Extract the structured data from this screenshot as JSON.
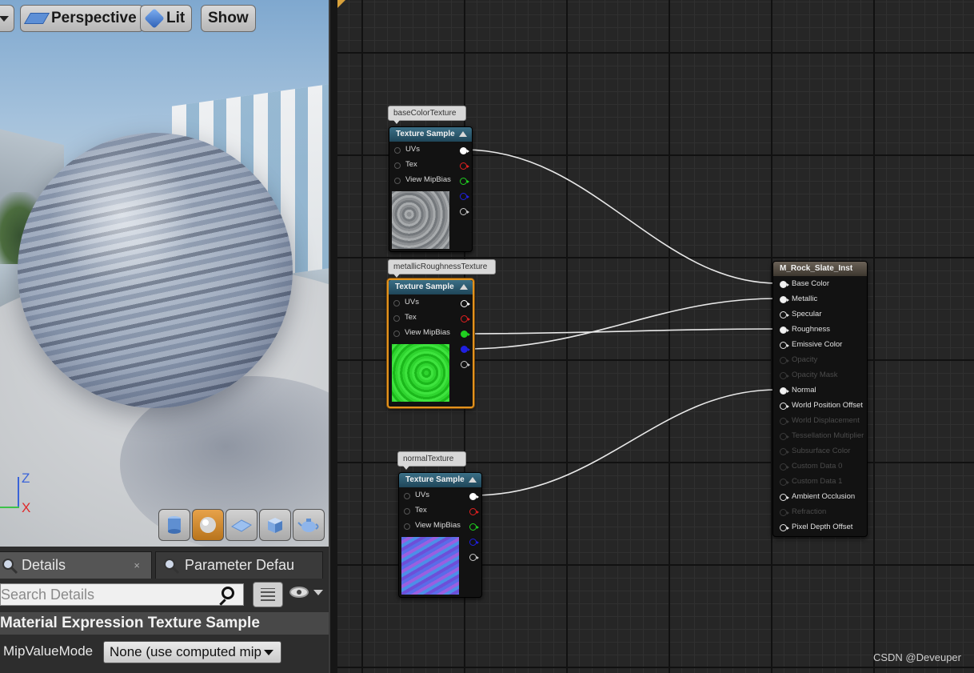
{
  "viewport": {
    "toolbar": {
      "perspective": "Perspective",
      "lit": "Lit",
      "show": "Show"
    },
    "axes": {
      "z": "Z",
      "x": "X"
    },
    "preview_shapes": [
      "cylinder-icon",
      "sphere-icon",
      "plane-icon",
      "cube-icon",
      "teapot-icon"
    ]
  },
  "details": {
    "tabs": [
      {
        "label": "Details",
        "close": "×"
      },
      {
        "label": "Parameter Defau"
      }
    ],
    "search_placeholder": "Search Details",
    "section": "Material Expression Texture Sample",
    "property": {
      "label": "MipValueMode",
      "value": "None (use computed mip"
    }
  },
  "graph": {
    "nodes": [
      {
        "comment": "baseColorTexture",
        "title": "Texture Sample",
        "pins": [
          "UVs",
          "Tex",
          "View MipBias"
        ]
      },
      {
        "comment": "metallicRoughnessTexture",
        "title": "Texture Sample",
        "pins": [
          "UVs",
          "Tex",
          "View MipBias"
        ]
      },
      {
        "comment": "normalTexture",
        "title": "Texture Sample",
        "pins": [
          "UVs",
          "Tex",
          "View MipBias"
        ]
      }
    ],
    "material": {
      "title": "M_Rock_Slate_Inst",
      "pins": [
        {
          "label": "Base Color",
          "state": "connected"
        },
        {
          "label": "Metallic",
          "state": "connected"
        },
        {
          "label": "Specular",
          "state": "enabled"
        },
        {
          "label": "Roughness",
          "state": "connected"
        },
        {
          "label": "Emissive Color",
          "state": "enabled"
        },
        {
          "label": "Opacity",
          "state": "disabled"
        },
        {
          "label": "Opacity Mask",
          "state": "disabled"
        },
        {
          "label": "Normal",
          "state": "connected"
        },
        {
          "label": "World Position Offset",
          "state": "enabled"
        },
        {
          "label": "World Displacement",
          "state": "disabled"
        },
        {
          "label": "Tessellation Multiplier",
          "state": "disabled"
        },
        {
          "label": "Subsurface Color",
          "state": "disabled"
        },
        {
          "label": "Custom Data 0",
          "state": "disabled"
        },
        {
          "label": "Custom Data 1",
          "state": "disabled"
        },
        {
          "label": "Ambient Occlusion",
          "state": "enabled"
        },
        {
          "label": "Refraction",
          "state": "disabled"
        },
        {
          "label": "Pixel Depth Offset",
          "state": "enabled"
        }
      ]
    },
    "output_pin_colors": [
      "#ffffff",
      "#e02020",
      "#20d020",
      "#2020e0",
      "#c8c8c8"
    ],
    "accent": "#e3921d"
  },
  "watermark": "CSDN @Deveuper"
}
